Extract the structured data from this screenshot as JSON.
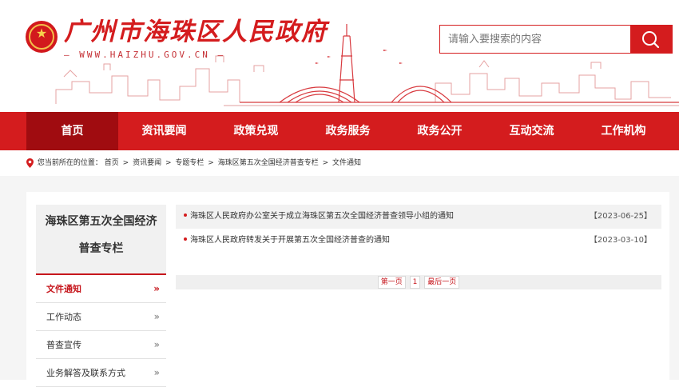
{
  "header": {
    "site_title": "广州市海珠区人民政府",
    "site_url": "— WWW.HAIZHU.GOV.CN —",
    "search_placeholder": "请输入要搜索的内容",
    "search_icon": "search-icon",
    "emblem_icon": "national-emblem-icon"
  },
  "nav": {
    "items": [
      "首页",
      "资讯要闻",
      "政策兑现",
      "政务服务",
      "政务公开",
      "互动交流",
      "工作机构"
    ],
    "active_index": 0
  },
  "breadcrumb": {
    "prefix": "您当前所在的位置：",
    "items": [
      "首页",
      "资讯要闻",
      "专题专栏",
      "海珠区第五次全国经济普查专栏",
      "文件通知"
    ],
    "separator": ">"
  },
  "sidebar": {
    "title": "海珠区第五次全国经济普查专栏",
    "items": [
      {
        "label": "文件通知",
        "active": true
      },
      {
        "label": "工作动态",
        "active": false
      },
      {
        "label": "普查宣传",
        "active": false
      },
      {
        "label": "业务解答及联系方式",
        "active": false
      }
    ],
    "chevron": "»"
  },
  "articles": [
    {
      "title": "海珠区人民政府办公室关于成立海珠区第五次全国经济普查领导小组的通知",
      "date": "【2023-06-25】"
    },
    {
      "title": "海珠区人民政府转发关于开展第五次全国经济普查的通知",
      "date": "【2023-03-10】"
    }
  ],
  "pager": {
    "first": "第一页",
    "page": "1",
    "last": "最后一页"
  },
  "colors": {
    "brand_red": "#d41c1e",
    "nav_active": "#a00c10"
  }
}
